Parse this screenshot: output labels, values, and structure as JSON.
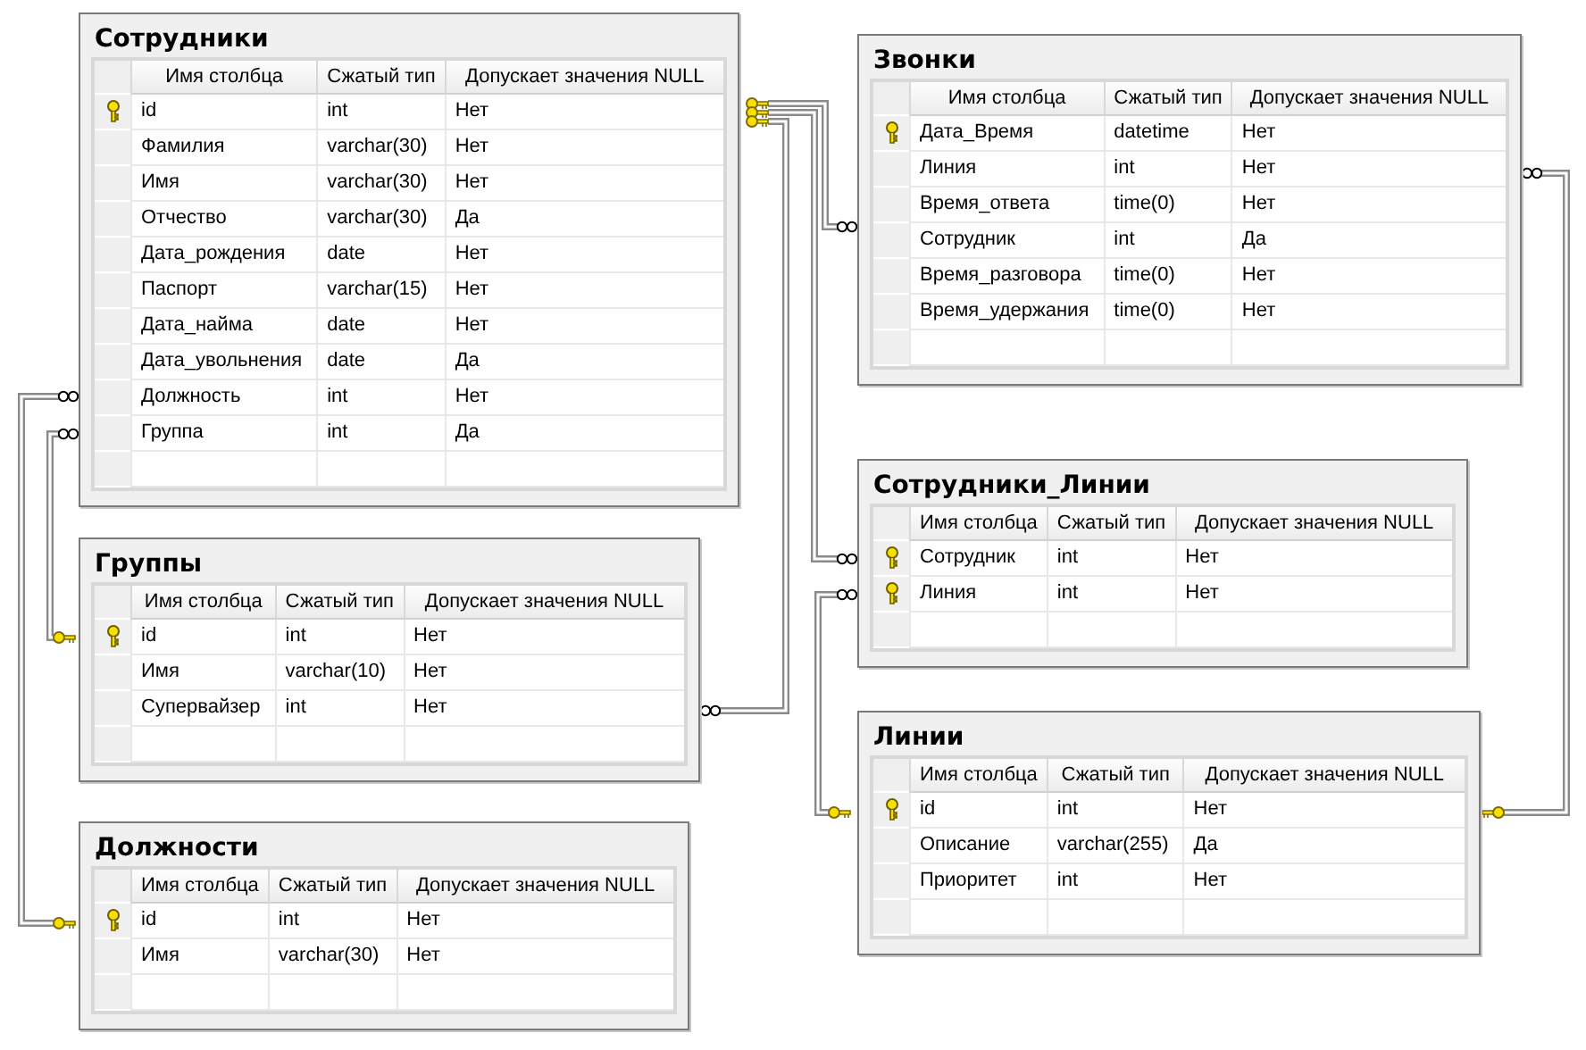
{
  "tables": [
    {
      "name": "Сотрудники",
      "columns": [
        "Имя столбца",
        "Сжатый тип",
        "Допускает значения NULL"
      ],
      "rows": [
        {
          "name": "id",
          "type": "int",
          "nullable": "Нет",
          "primary_key": true
        },
        {
          "name": "Фамилия",
          "type": "varchar(30)",
          "nullable": "Нет",
          "primary_key": false
        },
        {
          "name": "Имя",
          "type": "varchar(30)",
          "nullable": "Нет",
          "primary_key": false
        },
        {
          "name": "Отчество",
          "type": "varchar(30)",
          "nullable": "Да",
          "primary_key": false
        },
        {
          "name": "Дата_рождения",
          "type": "date",
          "nullable": "Нет",
          "primary_key": false
        },
        {
          "name": "Паспорт",
          "type": "varchar(15)",
          "nullable": "Нет",
          "primary_key": false
        },
        {
          "name": "Дата_найма",
          "type": "date",
          "nullable": "Нет",
          "primary_key": false
        },
        {
          "name": "Дата_увольнения",
          "type": "date",
          "nullable": "Да",
          "primary_key": false
        },
        {
          "name": "Должность",
          "type": "int",
          "nullable": "Нет",
          "primary_key": false
        },
        {
          "name": "Группа",
          "type": "int",
          "nullable": "Да",
          "primary_key": false
        }
      ]
    },
    {
      "name": "Звонки",
      "columns": [
        "Имя столбца",
        "Сжатый тип",
        "Допускает значения NULL"
      ],
      "rows": [
        {
          "name": "Дата_Время",
          "type": "datetime",
          "nullable": "Нет",
          "primary_key": true
        },
        {
          "name": "Линия",
          "type": "int",
          "nullable": "Нет",
          "primary_key": false
        },
        {
          "name": "Время_ответа",
          "type": "time(0)",
          "nullable": "Нет",
          "primary_key": false
        },
        {
          "name": "Сотрудник",
          "type": "int",
          "nullable": "Да",
          "primary_key": false
        },
        {
          "name": "Время_разговора",
          "type": "time(0)",
          "nullable": "Нет",
          "primary_key": false
        },
        {
          "name": "Время_удержания",
          "type": "time(0)",
          "nullable": "Нет",
          "primary_key": false
        }
      ]
    },
    {
      "name": "Сотрудники_Линии",
      "columns": [
        "Имя столбца",
        "Сжатый тип",
        "Допускает значения NULL"
      ],
      "rows": [
        {
          "name": "Сотрудник",
          "type": "int",
          "nullable": "Нет",
          "primary_key": true
        },
        {
          "name": "Линия",
          "type": "int",
          "nullable": "Нет",
          "primary_key": true
        }
      ]
    },
    {
      "name": "Группы",
      "columns": [
        "Имя столбца",
        "Сжатый тип",
        "Допускает значения NULL"
      ],
      "rows": [
        {
          "name": "id",
          "type": "int",
          "nullable": "Нет",
          "primary_key": true
        },
        {
          "name": "Имя",
          "type": "varchar(10)",
          "nullable": "Нет",
          "primary_key": false
        },
        {
          "name": "Супервайзер",
          "type": "int",
          "nullable": "Нет",
          "primary_key": false
        }
      ]
    },
    {
      "name": "Должности",
      "columns": [
        "Имя столбца",
        "Сжатый тип",
        "Допускает значения NULL"
      ],
      "rows": [
        {
          "name": "id",
          "type": "int",
          "nullable": "Нет",
          "primary_key": true
        },
        {
          "name": "Имя",
          "type": "varchar(30)",
          "nullable": "Нет",
          "primary_key": false
        }
      ]
    },
    {
      "name": "Линии",
      "columns": [
        "Имя столбца",
        "Сжатый тип",
        "Допускает значения NULL"
      ],
      "rows": [
        {
          "name": "id",
          "type": "int",
          "nullable": "Нет",
          "primary_key": true
        },
        {
          "name": "Описание",
          "type": "varchar(255)",
          "nullable": "Да",
          "primary_key": false
        },
        {
          "name": "Приоритет",
          "type": "int",
          "nullable": "Нет",
          "primary_key": false
        }
      ]
    }
  ]
}
